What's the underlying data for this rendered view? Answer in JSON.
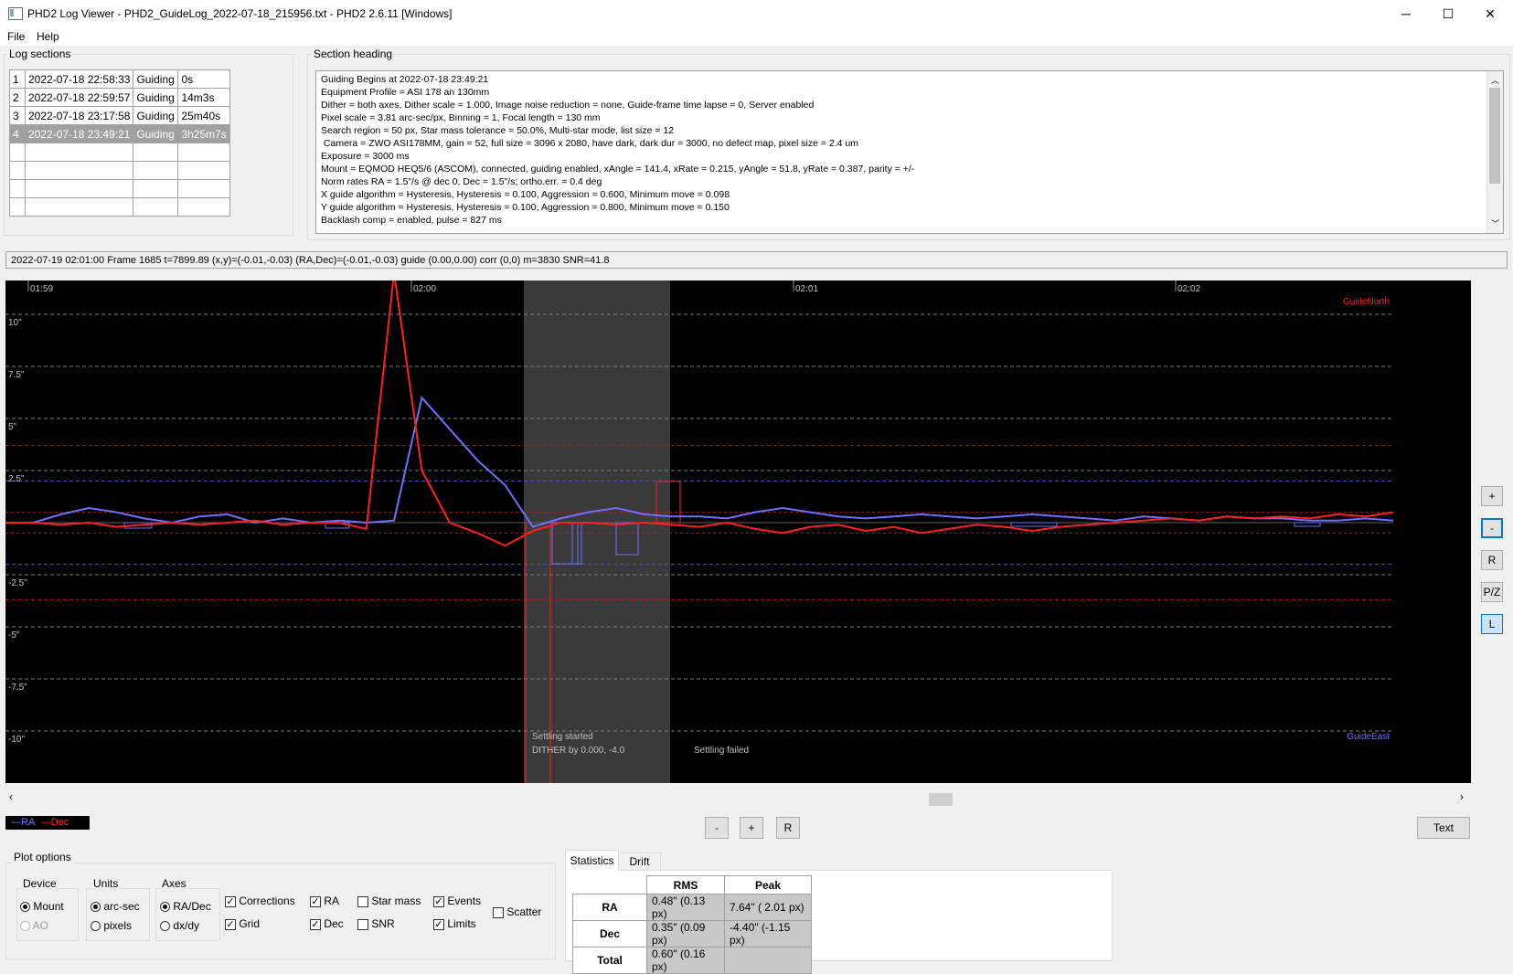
{
  "window": {
    "title": "PHD2 Log Viewer - PHD2_GuideLog_2022-07-18_215956.txt - PHD2 2.6.11 [Windows]",
    "controls": {
      "minimize": "─",
      "maximize": "☐",
      "close": "✕"
    }
  },
  "menu": {
    "file": "File",
    "help": "Help"
  },
  "log_sections": {
    "title": "Log sections",
    "rows": [
      {
        "num": "1",
        "time": "2022-07-18 22:58:33",
        "type": "Guiding",
        "duration": "0s"
      },
      {
        "num": "2",
        "time": "2022-07-18 22:59:57",
        "type": "Guiding",
        "duration": "14m3s"
      },
      {
        "num": "3",
        "time": "2022-07-18 23:17:58",
        "type": "Guiding",
        "duration": "25m40s"
      },
      {
        "num": "4",
        "time": "2022-07-18 23:49:21",
        "type": "Guiding",
        "duration": "3h25m7s"
      }
    ],
    "selected_index": 3
  },
  "section_heading": {
    "title": "Section heading",
    "lines": [
      "Guiding Begins at 2022-07-18 23:49:21",
      "Equipment Profile = ASI 178 an 130mm",
      "Dither = both axes, Dither scale = 1.000, Image noise reduction = none, Guide-frame time lapse = 0, Server enabled",
      "Pixel scale = 3.81 arc-sec/px, Binning = 1, Focal length = 130 mm",
      "Search region = 50 px, Star mass tolerance = 50.0%, Multi-star mode, list size = 12",
      " Camera = ZWO ASI178MM, gain = 52, full size = 3096 x 2080, have dark, dark dur = 3000, no defect map, pixel size = 2.4 um",
      "Exposure = 3000 ms",
      "Mount = EQMOD HEQ5/6 (ASCOM), connected, guiding enabled, xAngle = 141.4, xRate = 0.215, yAngle = 51.8, yRate = 0.387, parity = +/-",
      "Norm rates RA = 1.5\"/s @ dec 0, Dec = 1.5\"/s; ortho.err. = 0.4 deg",
      "X guide algorithm = Hysteresis, Hysteresis = 0.100, Aggression = 0.600, Minimum move = 0.098",
      "Y guide algorithm = Hysteresis, Hysteresis = 0.100, Aggression = 0.800, Minimum move = 0.150",
      "Backlash comp = enabled, pulse = 827 ms"
    ]
  },
  "status_line": "2022-07-19 02:01:00 Frame 1685 t=7899.89 (x,y)=(-0.01,-0.03) (RA,Dec)=(-0.01,-0.03) guide (0.00,0.00) corr (0,0) m=3830 SNR=41.8",
  "plot": {
    "time_ticks": [
      "01:59",
      "02:00",
      "02:01",
      "02:02"
    ],
    "y_ticks": [
      "10\"",
      "7.5\"",
      "5\"",
      "2.5\"",
      "-2.5\"",
      "-5\"",
      "-7.5\"",
      "-10\""
    ],
    "label_north": "GuideNorth",
    "label_east": "GuideEast",
    "event_settling_started": "Settling started",
    "event_dither": "DITHER by 0.000, -4.0",
    "event_settling_failed": "Settling failed",
    "colors": {
      "ra": "#7070ff",
      "dec": "#ff2020",
      "grid": "#808080",
      "settle": "#3a3a3a"
    }
  },
  "chart_data": {
    "type": "line",
    "xlabel": "",
    "ylabel": "",
    "ylim": [
      -11,
      11
    ],
    "y_unit": "arc-sec",
    "x": [
      0,
      1,
      2,
      3,
      4,
      5,
      6,
      7,
      8,
      9,
      10,
      11,
      12,
      13,
      14,
      15,
      16,
      17,
      18,
      19,
      20,
      21,
      22,
      23,
      24,
      25,
      26,
      27,
      28,
      29,
      30,
      31,
      32,
      33,
      34,
      35,
      36,
      37,
      38,
      39,
      40,
      41,
      42,
      43,
      44,
      45,
      46,
      47,
      48,
      49,
      50
    ],
    "series": [
      {
        "name": "RA",
        "values": [
          0.0,
          0.0,
          0.4,
          0.7,
          0.5,
          0.2,
          0.0,
          0.3,
          0.4,
          0.0,
          0.2,
          0.0,
          0.1,
          0.0,
          0.1,
          6.0,
          4.5,
          3.0,
          1.8,
          -0.2,
          0.2,
          0.5,
          0.7,
          0.4,
          0.3,
          0.3,
          0.2,
          0.5,
          0.7,
          0.5,
          0.3,
          0.2,
          0.3,
          0.4,
          0.3,
          0.2,
          0.3,
          0.4,
          0.3,
          0.2,
          0.1,
          0.3,
          0.2,
          0.1,
          0.3,
          0.2,
          0.2,
          0.1,
          0.1,
          0.2,
          0.1
        ]
      },
      {
        "name": "Dec",
        "values": [
          0.0,
          0.0,
          -0.1,
          0.0,
          -0.2,
          -0.1,
          0.0,
          -0.1,
          0.0,
          0.1,
          -0.1,
          0.0,
          0.0,
          -0.3,
          12.0,
          2.5,
          0.0,
          -0.5,
          -1.1,
          -0.4,
          0.0,
          0.0,
          -0.1,
          0.0,
          -0.1,
          -0.2,
          0.0,
          -0.3,
          -0.5,
          -0.2,
          -0.1,
          -0.4,
          -0.2,
          -0.5,
          -0.3,
          -0.1,
          -0.2,
          -0.4,
          -0.2,
          -0.1,
          0.0,
          0.1,
          0.2,
          0.1,
          0.3,
          0.2,
          0.3,
          0.2,
          0.4,
          0.3,
          0.5
        ]
      }
    ]
  },
  "legend": {
    "ra": "RA",
    "dec": "Dec"
  },
  "plot_buttons": {
    "zoom_in": "+",
    "zoom_out": "-",
    "reset": "R",
    "pz": "P/Z",
    "lock": "L"
  },
  "bottom_buttons": {
    "minus": "-",
    "plus": "+",
    "reset": "R",
    "text": "Text"
  },
  "plot_options": {
    "title": "Plot options",
    "device": {
      "title": "Device",
      "mount": "Mount",
      "ao": "AO"
    },
    "units": {
      "title": "Units",
      "arcsec": "arc-sec",
      "pixels": "pixels"
    },
    "axes": {
      "title": "Axes",
      "radec": "RA/Dec",
      "dxdy": "dx/dy"
    },
    "checks": {
      "corrections": "Corrections",
      "grid": "Grid",
      "ra": "RA",
      "dec": "Dec",
      "star_mass": "Star mass",
      "snr": "SNR",
      "events": "Events",
      "limits": "Limits",
      "scatter": "Scatter"
    }
  },
  "stats": {
    "tab_statistics": "Statistics",
    "tab_drift": "Drift",
    "col_rms": "RMS",
    "col_peak": "Peak",
    "rows": [
      {
        "label": "RA",
        "rms": "0.48\" (0.13 px)",
        "peak": "7.64\" ( 2.01 px)"
      },
      {
        "label": "Dec",
        "rms": "0.35\" (0.09 px)",
        "peak": "-4.40\" (-1.15 px)"
      },
      {
        "label": "Total",
        "rms": "0.60\" (0.16 px)",
        "peak": ""
      }
    ]
  }
}
